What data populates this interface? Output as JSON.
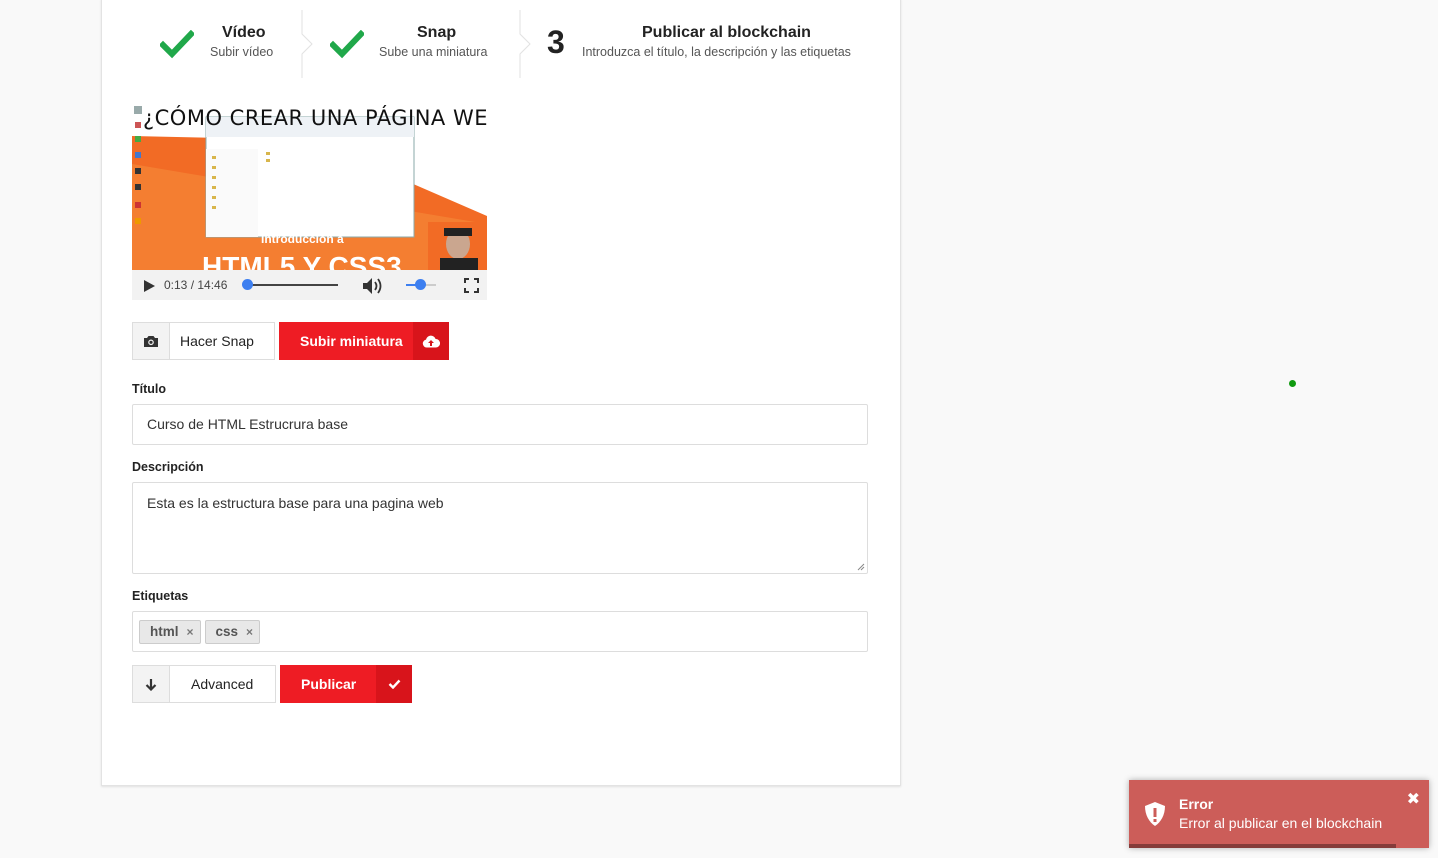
{
  "steps": [
    {
      "title": "Vídeo",
      "subtitle": "Subir vídeo",
      "status": "done",
      "icon": "check-icon"
    },
    {
      "title": "Snap",
      "subtitle": "Sube una miniatura",
      "status": "done",
      "icon": "check-icon"
    },
    {
      "number": "3",
      "title": "Publicar al blockchain",
      "subtitle": "Introduzca el título, la descripción y las etiquetas",
      "status": "active"
    }
  ],
  "video": {
    "thumbnail_text_top": "¿CÓMO CREAR UNA PÁGINA WEB?",
    "thumbnail_text_mid": "Introducción a",
    "thumbnail_text_big": "HTML5 Y CSS3",
    "current_time": "0:13",
    "time_separator": " / ",
    "duration": "14:46",
    "progress_fraction": 0.015,
    "volume_fraction": 0.5
  },
  "snap_buttons": {
    "snap_label": "Hacer Snap",
    "upload_label": "Subir miniatura"
  },
  "form": {
    "title_label": "Título",
    "title_value": "Curso de HTML Estrucrura base",
    "description_label": "Descripción",
    "description_value": "Esta es la estructura base para una pagina web",
    "tags_label": "Etiquetas",
    "tags": [
      "html",
      "css"
    ],
    "tag_remove": "×"
  },
  "actions": {
    "advanced_label": "Advanced",
    "publish_label": "Publicar"
  },
  "toast": {
    "title": "Error",
    "message": "Error al publicar en el blockchain",
    "close": "✖",
    "progress_fraction": 0.89
  },
  "colors": {
    "accent_red": "#ee1c24",
    "check_green": "#20a84a",
    "toast_bg": "#cc5d59",
    "player_blue": "#3d7ff0"
  }
}
